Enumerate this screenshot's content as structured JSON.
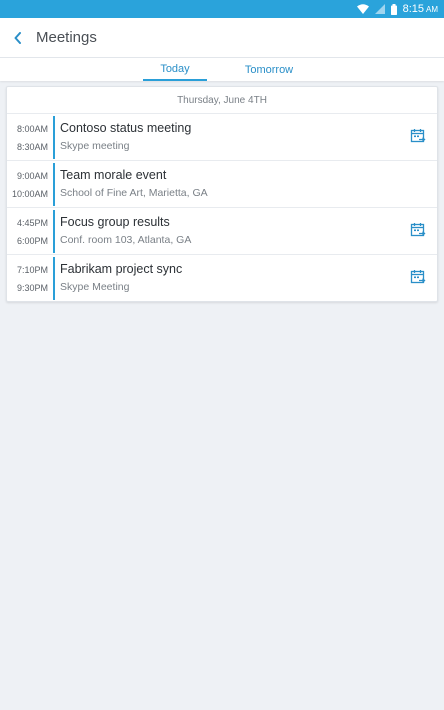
{
  "statusbar": {
    "time": "8:15",
    "ampm": "AM",
    "icons": [
      "wifi-icon",
      "cell-signal-icon",
      "battery-icon"
    ]
  },
  "header": {
    "back_icon": "chevron-left-icon",
    "title": "Meetings"
  },
  "tabs": [
    {
      "label": "Today",
      "selected": true
    },
    {
      "label": "Tomorrow",
      "selected": false
    }
  ],
  "date_header": "Thursday, June 4TH",
  "meetings": [
    {
      "start": "8:00AM",
      "end": "8:30AM",
      "title": "Contoso status meeting",
      "location": "Skype meeting",
      "has_join": true
    },
    {
      "start": "9:00AM",
      "end": "10:00AM",
      "title": "Team morale event",
      "location": "School of Fine Art, Marietta, GA",
      "has_join": false
    },
    {
      "start": "4:45PM",
      "end": "6:00PM",
      "title": "Focus group results",
      "location": "Conf. room 103, Atlanta, GA",
      "has_join": true
    },
    {
      "start": "7:10PM",
      "end": "9:30PM",
      "title": "Fabrikam project sync",
      "location": "Skype Meeting",
      "has_join": true
    }
  ],
  "colors": {
    "accent": "#2a9fd8",
    "statusbar": "#2aa3db",
    "background": "#eef1f5"
  }
}
